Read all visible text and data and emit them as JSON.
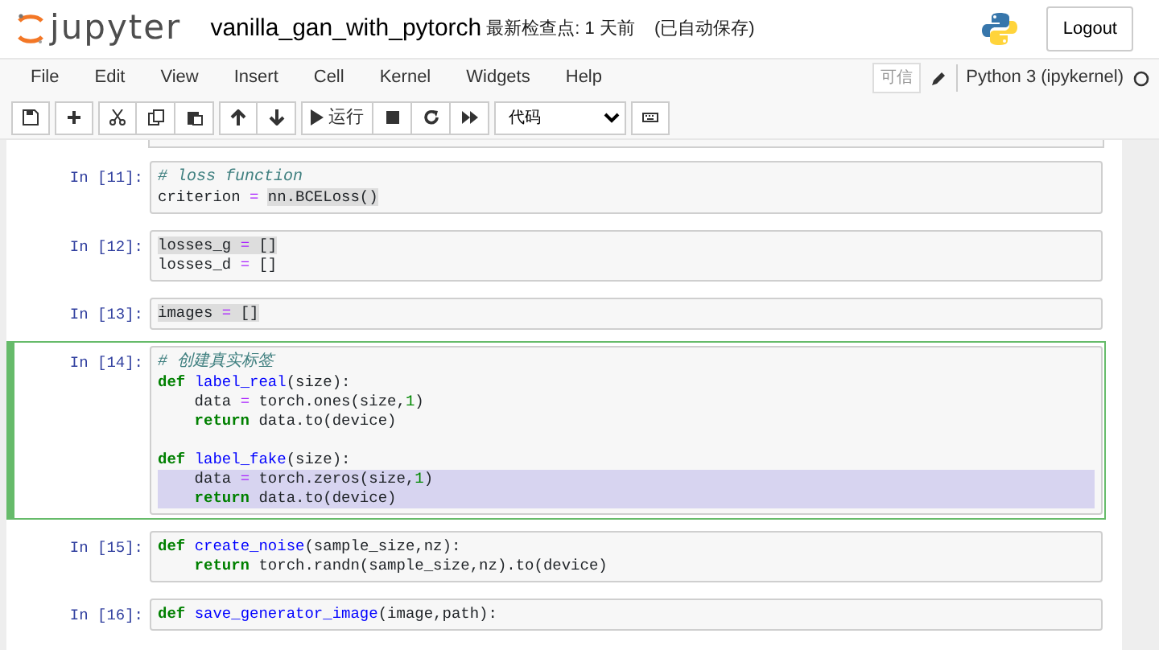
{
  "header": {
    "logo_text": "jupyter",
    "notebook_name": "vanilla_gan_with_pytorch",
    "checkpoint": "最新检查点: 1 天前",
    "autosave": "(已自动保存)",
    "logout": "Logout"
  },
  "menu": [
    "File",
    "Edit",
    "View",
    "Insert",
    "Cell",
    "Kernel",
    "Widgets",
    "Help"
  ],
  "trusted": "可信",
  "kernel": {
    "name": "Python 3 (ipykernel)",
    "busy": false
  },
  "toolbar": {
    "run_label": "运行",
    "cell_type": "代码"
  },
  "cells": [
    {
      "prompt": "In [11]:",
      "selected": false,
      "lines": [
        {
          "kind": "code",
          "selected": false,
          "marked": false,
          "tokens": [
            {
              "kind": "cm",
              "text": "# loss function"
            }
          ]
        },
        {
          "kind": "code",
          "selected": false,
          "marked": false,
          "tokens": [
            {
              "kind": "t",
              "text": "criterion "
            },
            {
              "kind": "op",
              "text": "= "
            },
            {
              "kind": "match",
              "text": "nn.BCELoss()"
            }
          ]
        }
      ]
    },
    {
      "prompt": "In [12]:",
      "selected": false,
      "lines": [
        {
          "kind": "code",
          "selected": false,
          "marked": true,
          "tokens": [
            {
              "kind": "t",
              "text": "losses_g "
            },
            {
              "kind": "op",
              "text": "="
            },
            {
              "kind": "t",
              "text": " []"
            }
          ]
        },
        {
          "kind": "code",
          "selected": false,
          "marked": false,
          "tokens": [
            {
              "kind": "t",
              "text": "losses_d "
            },
            {
              "kind": "op",
              "text": "="
            },
            {
              "kind": "t",
              "text": " []"
            }
          ]
        }
      ]
    },
    {
      "prompt": "In [13]:",
      "selected": false,
      "lines": [
        {
          "kind": "code",
          "selected": false,
          "marked": true,
          "tokens": [
            {
              "kind": "t",
              "text": "images "
            },
            {
              "kind": "op",
              "text": "="
            },
            {
              "kind": "t",
              "text": " []"
            }
          ]
        }
      ]
    },
    {
      "prompt": "In [14]:",
      "selected": true,
      "lines": [
        {
          "kind": "code",
          "selected": false,
          "marked": false,
          "tokens": [
            {
              "kind": "cm",
              "text": "# 创建真实标签"
            }
          ]
        },
        {
          "kind": "code",
          "selected": false,
          "marked": false,
          "tokens": [
            {
              "kind": "kw",
              "text": "def "
            },
            {
              "kind": "fn",
              "text": "label_real"
            },
            {
              "kind": "t",
              "text": "(size):"
            }
          ]
        },
        {
          "kind": "code",
          "selected": false,
          "marked": false,
          "tokens": [
            {
              "kind": "t",
              "text": "    data "
            },
            {
              "kind": "op",
              "text": "="
            },
            {
              "kind": "t",
              "text": " torch.ones(size,"
            },
            {
              "kind": "num",
              "text": "1"
            },
            {
              "kind": "t",
              "text": ")"
            }
          ]
        },
        {
          "kind": "code",
          "selected": false,
          "marked": false,
          "tokens": [
            {
              "kind": "kw",
              "text": "    return"
            },
            {
              "kind": "t",
              "text": " data.to(device)"
            }
          ]
        },
        {
          "kind": "blank"
        },
        {
          "kind": "code",
          "selected": false,
          "marked": false,
          "tokens": [
            {
              "kind": "kw",
              "text": "def "
            },
            {
              "kind": "fn",
              "text": "label_fake"
            },
            {
              "kind": "t",
              "text": "(size):"
            }
          ]
        },
        {
          "kind": "code",
          "selected": true,
          "marked": false,
          "tokens": [
            {
              "kind": "t",
              "text": "    data "
            },
            {
              "kind": "op",
              "text": "="
            },
            {
              "kind": "t",
              "text": " torch.zeros(size,"
            },
            {
              "kind": "num",
              "text": "1"
            },
            {
              "kind": "t",
              "text": ")"
            }
          ]
        },
        {
          "kind": "code",
          "selected": true,
          "marked": false,
          "tokens": [
            {
              "kind": "kw",
              "text": "    return"
            },
            {
              "kind": "t",
              "text": " data.to(device)"
            }
          ]
        }
      ]
    },
    {
      "prompt": "In [15]:",
      "selected": false,
      "lines": [
        {
          "kind": "code",
          "selected": false,
          "marked": false,
          "tokens": [
            {
              "kind": "kw",
              "text": "def "
            },
            {
              "kind": "fn",
              "text": "create_noise"
            },
            {
              "kind": "t",
              "text": "(sample_size,nz):"
            }
          ]
        },
        {
          "kind": "code",
          "selected": false,
          "marked": false,
          "tokens": [
            {
              "kind": "kw",
              "text": "    return"
            },
            {
              "kind": "t",
              "text": " torch.randn(sample_size,nz).to(device)"
            }
          ]
        }
      ]
    },
    {
      "prompt": "In [16]:",
      "selected": false,
      "lines": [
        {
          "kind": "code",
          "selected": false,
          "marked": false,
          "tokens": [
            {
              "kind": "kw",
              "text": "def "
            },
            {
              "kind": "fn",
              "text": "save_generator_image"
            },
            {
              "kind": "t",
              "text": "(image,path):"
            }
          ]
        }
      ]
    }
  ]
}
